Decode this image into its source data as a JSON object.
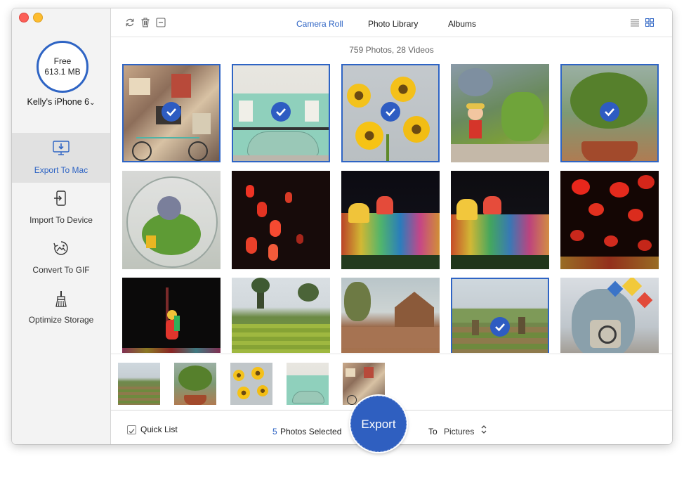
{
  "sidebar": {
    "storage": {
      "free_label": "Free",
      "size": "613.1 MB"
    },
    "device_name": "Kelly's iPhone 6",
    "items": [
      {
        "label": "Export To Mac",
        "icon": "monitor-export-icon",
        "active": true
      },
      {
        "label": "Import To Device",
        "icon": "phone-import-icon",
        "active": false
      },
      {
        "label": "Convert To GIF",
        "icon": "gif-convert-icon",
        "active": false
      },
      {
        "label": "Optimize Storage",
        "icon": "broom-icon",
        "active": false
      }
    ]
  },
  "toolbar": {
    "icons": [
      "refresh-icon",
      "trash-icon",
      "deselect-icon"
    ],
    "view_icons": [
      "list-view-icon",
      "grid-view-icon"
    ]
  },
  "tabs": [
    {
      "label": "Camera Roll",
      "active": true
    },
    {
      "label": "Photo Library",
      "active": false
    },
    {
      "label": "Albums",
      "active": false
    }
  ],
  "summary": "759 Photos, 28 Videos",
  "photos": [
    {
      "subject": "collage wall with bicycle",
      "selected": true
    },
    {
      "subject": "green building with vintage car",
      "selected": true
    },
    {
      "subject": "yellow gerbera flowers",
      "selected": true
    },
    {
      "subject": "succulents with figurine",
      "selected": false
    },
    {
      "subject": "potted green plant",
      "selected": true
    },
    {
      "subject": "glass terrarium",
      "selected": false
    },
    {
      "subject": "red lanterns at night",
      "selected": false
    },
    {
      "subject": "lantern festival display",
      "selected": false
    },
    {
      "subject": "lantern festival display",
      "selected": false
    },
    {
      "subject": "red lanterns on dark sky",
      "selected": false
    },
    {
      "subject": "lit monkey king lantern",
      "selected": false
    },
    {
      "subject": "green field with trees",
      "selected": false
    },
    {
      "subject": "wooden buildings in village",
      "selected": false
    },
    {
      "subject": "rural farmland",
      "selected": true
    },
    {
      "subject": "elephant sculpture with pinwheels",
      "selected": false
    }
  ],
  "quick_list": {
    "thumbs": [
      "rural farmland",
      "potted green plant",
      "yellow gerbera flowers",
      "green building with vintage car",
      "collage wall with bicycle"
    ]
  },
  "bottom": {
    "quick_list_label": "Quick List",
    "selected_count": "5",
    "selected_label": "Photos Selected",
    "export_label": "Export",
    "to_label": "To",
    "destination": "Pictures"
  },
  "colors": {
    "accent": "#2e64c4",
    "active_sidebar_bg": "#e1e1e1"
  }
}
